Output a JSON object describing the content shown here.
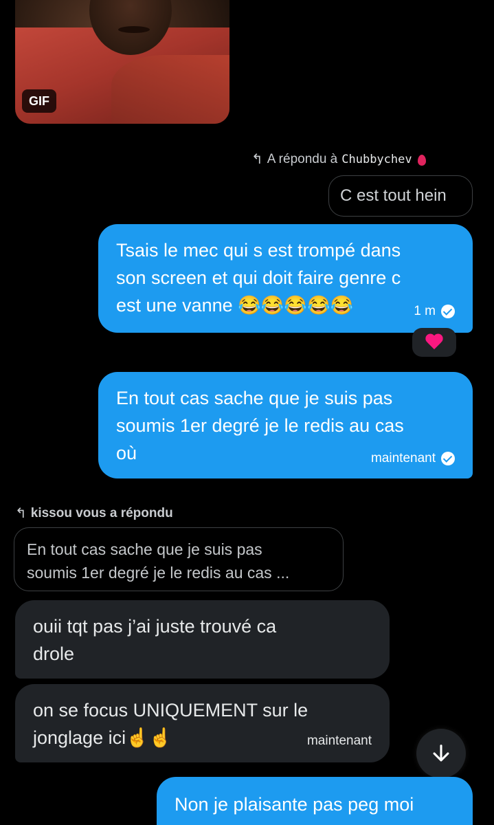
{
  "gif_message": {
    "badge": "GIF"
  },
  "reply_out": {
    "label": "A répondu à",
    "user": "Chubbychev",
    "quoted": "C est tout hein"
  },
  "messages_out": [
    {
      "text_lines": [
        "Tsais le mec qui s est trompé dans",
        "son screen et qui doit faire genre c",
        "est une vanne 😂😂😂😂😂"
      ],
      "time": "1 m",
      "reaction": "heart"
    },
    {
      "text_lines": [
        "En tout cas sache que je suis pas",
        "soumis 1er degré je le redis au cas",
        "où"
      ],
      "time": "maintenant"
    }
  ],
  "reply_in": {
    "label": "kissou vous a répondu",
    "quoted_lines": [
      "En tout cas sache que je suis pas",
      "soumis 1er degré je le redis au cas ..."
    ]
  },
  "messages_in": [
    {
      "text_lines": [
        "ouii tqt pas j’ai juste trouvé ca",
        "drole"
      ]
    },
    {
      "text_lines": [
        "on se focus UNIQUEMENT sur le",
        "jonglage ici☝️☝️"
      ],
      "time": "maintenant"
    }
  ],
  "last_message_partial": "Non je plaisante pas peg moi",
  "colors": {
    "outgoing": "#1d9bf0",
    "incoming": "#202327",
    "background": "#000000"
  },
  "icons": {
    "reply": "reply-arrow-icon",
    "scroll": "arrow-down-icon",
    "sent": "check-circle-icon",
    "reaction": "heart-icon"
  }
}
